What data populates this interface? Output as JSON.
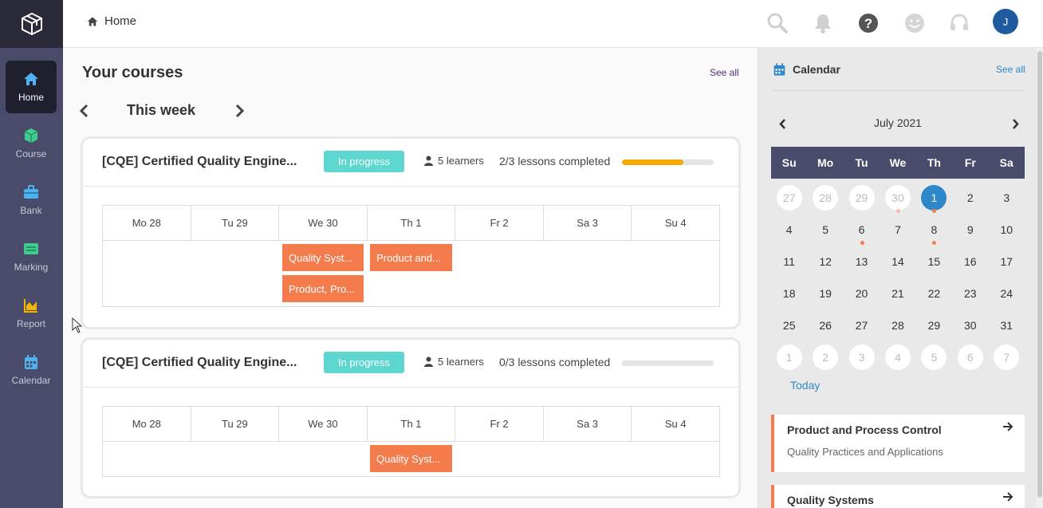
{
  "sidebar": {
    "items": [
      {
        "label": "Home",
        "icon": "home-icon",
        "active": true
      },
      {
        "label": "Course",
        "icon": "cube-icon",
        "active": false
      },
      {
        "label": "Bank",
        "icon": "briefcase-icon",
        "active": false
      },
      {
        "label": "Marking",
        "icon": "list-icon",
        "active": false
      },
      {
        "label": "Report",
        "icon": "chart-icon",
        "active": false
      },
      {
        "label": "Calendar",
        "icon": "calendar-icon",
        "active": false
      }
    ],
    "accent_colors": {
      "home": "#4db4f0",
      "course": "#3ecf8e",
      "bank": "#4db4f0",
      "marking": "#3ecf8e",
      "report": "#f5b400",
      "calendar": "#4db4f0"
    }
  },
  "topbar": {
    "breadcrumb": "Home",
    "avatar_initial": "J",
    "icons": [
      "search-icon",
      "bell-icon",
      "help-icon",
      "smiley-icon",
      "headset-icon"
    ]
  },
  "main": {
    "title": "Your courses",
    "see_all": "See all",
    "week_label": "This week",
    "courses": [
      {
        "name": "[CQE] Certified Quality Engine...",
        "status": "In progress",
        "learners": "5 learners",
        "lessons": "2/3 lessons completed",
        "progress": 0.67,
        "days": [
          "Mo 28",
          "Tu 29",
          "We 30",
          "Th 1",
          "Fr 2",
          "Sa 3",
          "Su 4"
        ],
        "events": [
          {
            "label": "Quality Syst...",
            "day": 2,
            "row": 0
          },
          {
            "label": "Product and...",
            "day": 3,
            "row": 0
          },
          {
            "label": "Product, Pro...",
            "day": 2,
            "row": 1
          }
        ]
      },
      {
        "name": "[CQE] Certified Quality Engine...",
        "status": "In progress",
        "learners": "5 learners",
        "lessons": "0/3 lessons completed",
        "progress": 0,
        "days": [
          "Mo 28",
          "Tu 29",
          "We 30",
          "Th 1",
          "Fr 2",
          "Sa 3",
          "Su 4"
        ],
        "events": [
          {
            "label": "Quality Syst...",
            "day": 3,
            "row": 0
          }
        ]
      }
    ]
  },
  "calendar": {
    "title": "Calendar",
    "see_all": "See all",
    "month": "July 2021",
    "weekdays": [
      "Su",
      "Mo",
      "Tu",
      "We",
      "Th",
      "Fr",
      "Sa"
    ],
    "weeks": [
      [
        {
          "d": "27",
          "other": true
        },
        {
          "d": "28",
          "other": true
        },
        {
          "d": "29",
          "other": true
        },
        {
          "d": "30",
          "other": true,
          "dot": "faint"
        },
        {
          "d": "1",
          "today": true,
          "dot": "solid"
        },
        {
          "d": "2"
        },
        {
          "d": "3"
        }
      ],
      [
        {
          "d": "4"
        },
        {
          "d": "5"
        },
        {
          "d": "6",
          "dot": "solid"
        },
        {
          "d": "7"
        },
        {
          "d": "8",
          "dot": "solid"
        },
        {
          "d": "9"
        },
        {
          "d": "10"
        }
      ],
      [
        {
          "d": "11"
        },
        {
          "d": "12"
        },
        {
          "d": "13"
        },
        {
          "d": "14"
        },
        {
          "d": "15"
        },
        {
          "d": "16"
        },
        {
          "d": "17"
        }
      ],
      [
        {
          "d": "18"
        },
        {
          "d": "19"
        },
        {
          "d": "20"
        },
        {
          "d": "21"
        },
        {
          "d": "22"
        },
        {
          "d": "23"
        },
        {
          "d": "24"
        }
      ],
      [
        {
          "d": "25"
        },
        {
          "d": "26"
        },
        {
          "d": "27"
        },
        {
          "d": "28"
        },
        {
          "d": "29"
        },
        {
          "d": "30"
        },
        {
          "d": "31"
        }
      ],
      [
        {
          "d": "1",
          "other": true
        },
        {
          "d": "2",
          "other": true
        },
        {
          "d": "3",
          "other": true
        },
        {
          "d": "4",
          "other": true
        },
        {
          "d": "5",
          "other": true
        },
        {
          "d": "6",
          "other": true
        },
        {
          "d": "7",
          "other": true
        }
      ]
    ],
    "today_link": "Today",
    "events": [
      {
        "title": "Product and Process Control",
        "subtitle": "Quality Practices and Applications"
      },
      {
        "title": "Quality Systems",
        "subtitle": ""
      }
    ]
  }
}
